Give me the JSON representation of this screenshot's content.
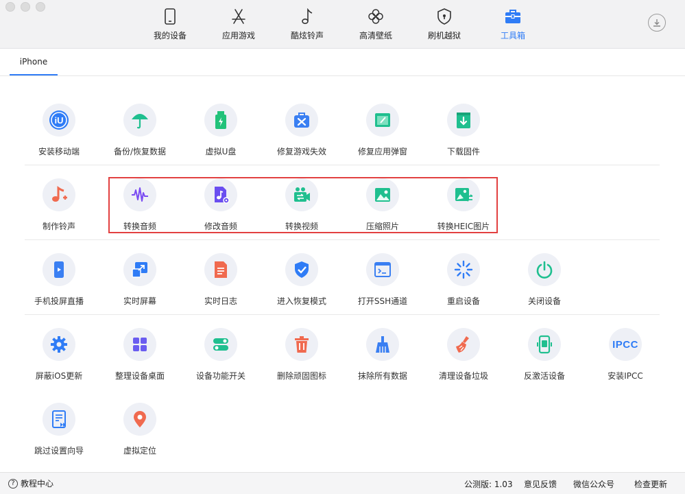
{
  "nav": [
    {
      "label": "我的设备",
      "icon": "phone-icon"
    },
    {
      "label": "应用游戏",
      "icon": "app-store-icon"
    },
    {
      "label": "酷炫铃声",
      "icon": "music-note-icon"
    },
    {
      "label": "高清壁纸",
      "icon": "clover-icon"
    },
    {
      "label": "刷机越狱",
      "icon": "shield-lock-icon"
    },
    {
      "label": "工具箱",
      "icon": "toolbox-icon",
      "active": true
    }
  ],
  "tab": {
    "label": "iPhone"
  },
  "tools": {
    "row1": [
      {
        "label": "安装移动端",
        "icon": "iu-logo-icon",
        "color": "#2f7cf6"
      },
      {
        "label": "备份/恢复数据",
        "icon": "umbrella-icon",
        "color": "#1fbf8f"
      },
      {
        "label": "虚拟U盘",
        "icon": "usb-drive-icon",
        "color": "#22c27a"
      },
      {
        "label": "修复游戏失效",
        "icon": "toolkit-icon",
        "color": "#3a7ff2"
      },
      {
        "label": "修复应用弹窗",
        "icon": "window-icon",
        "color": "#1fbf8f"
      },
      {
        "label": "下载固件",
        "icon": "download-box-icon",
        "color": "#1fbf8f"
      }
    ],
    "row2": [
      {
        "label": "制作铃声",
        "icon": "ringtone-plus-icon",
        "color": "#f06a4f"
      },
      {
        "label": "转换音频",
        "icon": "waveform-icon",
        "color": "#7a4bf2"
      },
      {
        "label": "修改音频",
        "icon": "audio-file-gear-icon",
        "color": "#6a4ef0"
      },
      {
        "label": "转换视频",
        "icon": "video-convert-icon",
        "color": "#1fbf8f"
      },
      {
        "label": "压缩照片",
        "icon": "photo-icon",
        "color": "#1fbf8f"
      },
      {
        "label": "转换HEIC图片",
        "icon": "heic-convert-icon",
        "color": "#1fbf8f"
      }
    ],
    "row3": [
      {
        "label": "手机投屏直播",
        "icon": "phone-cast-icon",
        "color": "#3a7ff2"
      },
      {
        "label": "实时屏幕",
        "icon": "screen-arrow-icon",
        "color": "#2f7cf6"
      },
      {
        "label": "实时日志",
        "icon": "log-file-icon",
        "color": "#f06a4f"
      },
      {
        "label": "进入恢复模式",
        "icon": "shield-check-icon",
        "color": "#2f7cf6"
      },
      {
        "label": "打开SSH通道",
        "icon": "terminal-icon",
        "color": "#3a7ff2"
      },
      {
        "label": "重启设备",
        "icon": "spinner-icon",
        "color": "#2f7cf6"
      },
      {
        "label": "关闭设备",
        "icon": "power-icon",
        "color": "#1fbf8f"
      }
    ],
    "row4": [
      {
        "label": "屏蔽iOS更新",
        "icon": "gear-icon",
        "color": "#2f7cf6"
      },
      {
        "label": "整理设备桌面",
        "icon": "grid-icon",
        "color": "#6a5cf0"
      },
      {
        "label": "设备功能开关",
        "icon": "toggle-icon",
        "color": "#1fbf8f"
      },
      {
        "label": "删除顽固图标",
        "icon": "trash-icon",
        "color": "#f06a4f"
      },
      {
        "label": "抹除所有数据",
        "icon": "broom-icon",
        "color": "#3a7ff2"
      },
      {
        "label": "清理设备垃圾",
        "icon": "cleaner-icon",
        "color": "#f06a4f"
      },
      {
        "label": "反激活设备",
        "icon": "phone-deactivate-icon",
        "color": "#1fbf8f"
      },
      {
        "label": "安装IPCC",
        "icon": "ipcc-text-icon",
        "color": "#2f7cf6",
        "text": "IPCC"
      }
    ],
    "row5": [
      {
        "label": "跳过设置向导",
        "icon": "skip-setup-icon",
        "color": "#2f7cf6"
      },
      {
        "label": "虚拟定位",
        "icon": "location-pin-icon",
        "color": "#f06a4f"
      }
    ]
  },
  "footer": {
    "help": "教程中心",
    "version": "公测版: 1.03",
    "feedback": "意见反馈",
    "wechat": "微信公众号",
    "update": "检查更新"
  }
}
